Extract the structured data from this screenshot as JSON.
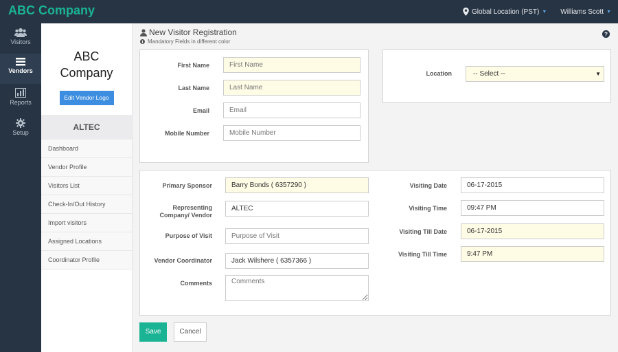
{
  "header": {
    "brand": "ABC Company",
    "location": "Global Location (PST)",
    "user": "Williams Scott",
    "accent_color": "#1ab394",
    "bar_color": "#273444"
  },
  "nav": {
    "items": [
      {
        "label": "Visitors",
        "icon": "users-icon"
      },
      {
        "label": "Vendors",
        "icon": "list-icon"
      },
      {
        "label": "Reports",
        "icon": "bar-chart-icon"
      },
      {
        "label": "Setup",
        "icon": "gear-icon"
      }
    ],
    "active": "Vendors"
  },
  "vendor": {
    "logo_line1": "ABC",
    "logo_line2": "Company",
    "edit_logo_label": "Edit Vendor Logo",
    "name": "ALTEC",
    "menu": [
      "Dashboard",
      "Vendor Profile",
      "Visitors List",
      "Check-In/Out History",
      "Import visitors",
      "Assigned Locations",
      "Coordinator Profile"
    ]
  },
  "page": {
    "title": "New Visitor Registration",
    "subtitle": "Mandatory Fields in different color"
  },
  "form": {
    "first_name": {
      "label": "First Name",
      "placeholder": "First Name"
    },
    "last_name": {
      "label": "Last Name",
      "placeholder": "Last Name"
    },
    "email": {
      "label": "Email",
      "placeholder": "Email"
    },
    "mobile": {
      "label": "Mobile Number",
      "placeholder": "Mobile Number"
    },
    "location": {
      "label": "Location",
      "value": "-- Select --"
    },
    "primary_sponsor": {
      "label": "Primary Sponsor",
      "value": "Barry Bonds ( 6357290 )"
    },
    "representing": {
      "label_line1": "Representing",
      "label_line2": "Company/ Vendor",
      "value": "ALTEC"
    },
    "purpose": {
      "label": "Purpose of Visit",
      "placeholder": "Purpose of Visit"
    },
    "coordinator": {
      "label": "Vendor Coordinator",
      "value": "Jack  Wilshere ( 6357366 )"
    },
    "comments": {
      "label": "Comments",
      "placeholder": "Comments"
    },
    "visiting_date": {
      "label": "Visiting Date",
      "value": "06-17-2015"
    },
    "visiting_time": {
      "label": "Visiting Time",
      "value": "09:47 PM"
    },
    "visiting_till_date": {
      "label": "Visiting Till Date",
      "value": "06-17-2015"
    },
    "visiting_till_time": {
      "label": "Visiting Till Time",
      "value": "9:47 PM"
    }
  },
  "actions": {
    "save": "Save",
    "cancel": "Cancel"
  }
}
